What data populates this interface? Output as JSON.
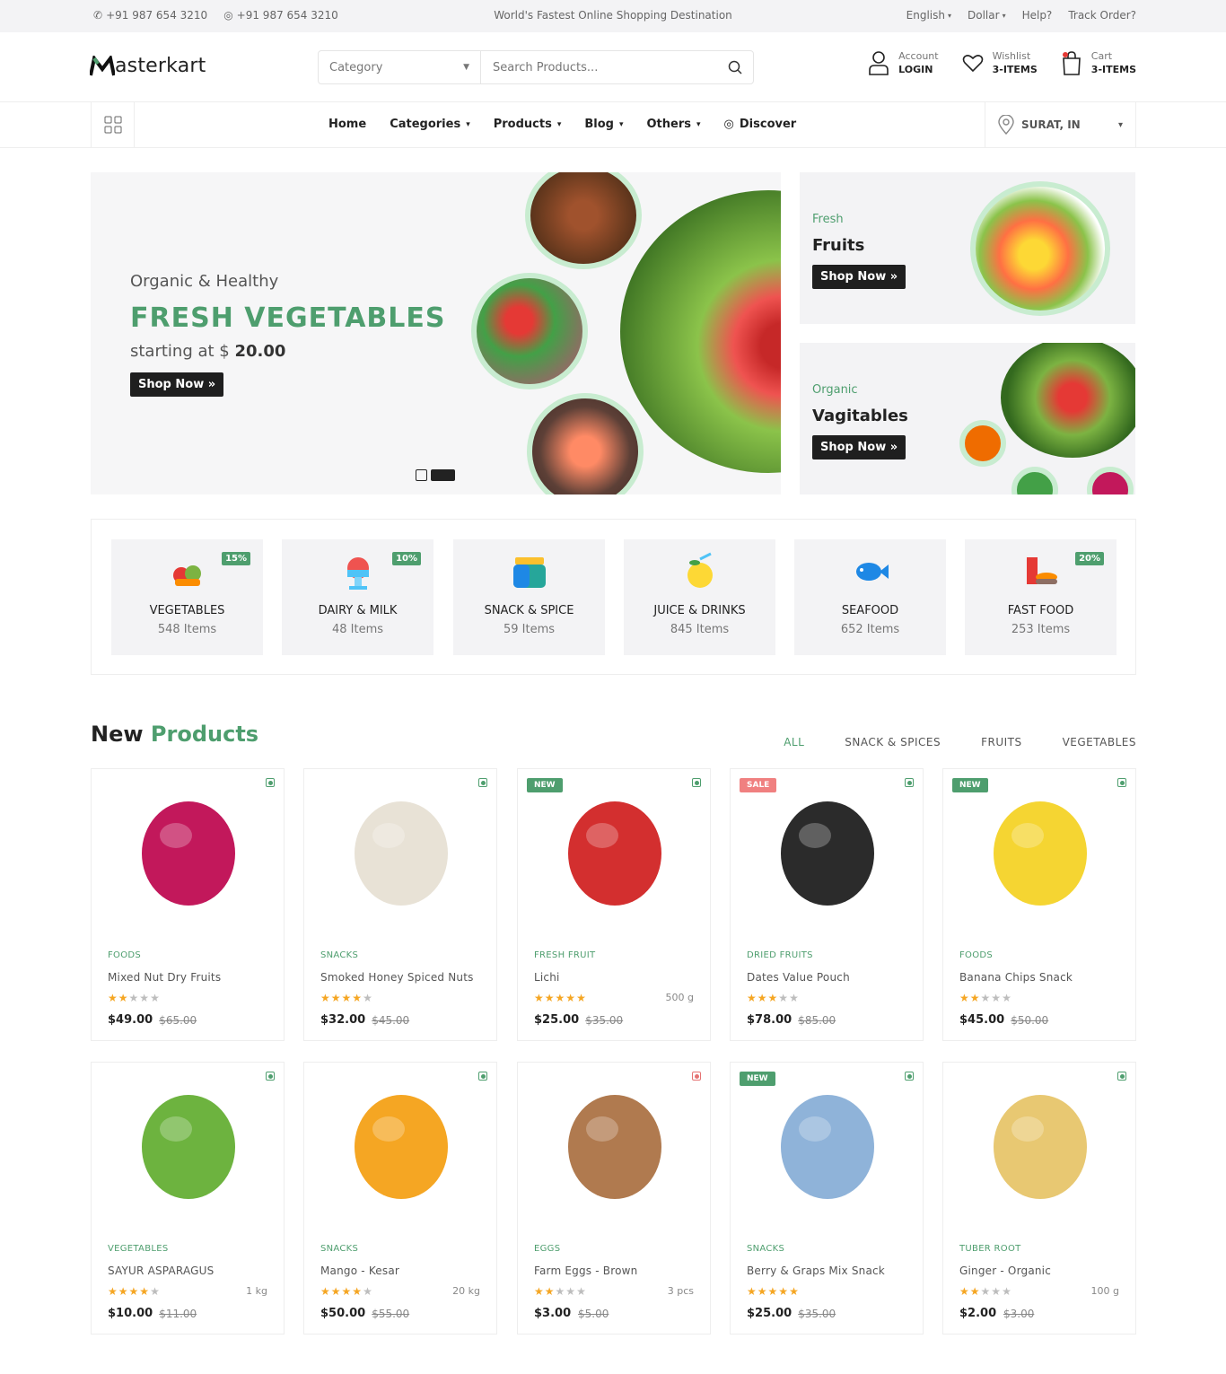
{
  "topbar": {
    "phone1": "+91 987 654 3210",
    "phone2": "+91 987 654 3210",
    "tagline": "World's Fastest Online Shopping Destination",
    "language": "English",
    "currency": "Dollar",
    "help": "Help?",
    "track": "Track Order?"
  },
  "header": {
    "logo_text": "asterkart",
    "category_label": "Category",
    "search_placeholder": "Search Products...",
    "account_label": "Account",
    "account_action": "LOGIN",
    "wishlist_label": "Wishlist",
    "wishlist_count": "3-ITEMS",
    "cart_label": "Cart",
    "cart_count": "3-ITEMS"
  },
  "nav": {
    "items": [
      "Home",
      "Categories",
      "Products",
      "Blog",
      "Others",
      "Discover"
    ],
    "location": "SURAT, IN"
  },
  "hero": {
    "subtitle": "Organic & Healthy",
    "title": "FRESH VEGETABLES",
    "price_prefix": "starting at $",
    "price": "20.00",
    "button": "Shop Now »"
  },
  "side_banners": [
    {
      "small": "Fresh",
      "big": "Fruits",
      "button": "Shop Now »"
    },
    {
      "small": "Organic",
      "big": "Vagitables",
      "button": "Shop Now »"
    }
  ],
  "categories": [
    {
      "name": "VEGETABLES",
      "count": "548 Items",
      "discount": "15%",
      "icon": "vegetables-icon"
    },
    {
      "name": "DAIRY & MILK",
      "count": "48 Items",
      "discount": "10%",
      "icon": "dairy-icon"
    },
    {
      "name": "SNACK & SPICE",
      "count": "59 Items",
      "discount": "",
      "icon": "snack-jar-icon"
    },
    {
      "name": "JUICE & DRINKS",
      "count": "845 Items",
      "discount": "",
      "icon": "juice-icon"
    },
    {
      "name": "SEAFOOD",
      "count": "652 Items",
      "discount": "",
      "icon": "fish-icon"
    },
    {
      "name": "FAST FOOD",
      "count": "253 Items",
      "discount": "20%",
      "icon": "fastfood-icon"
    }
  ],
  "new_products": {
    "title_a": "New",
    "title_b": "Products",
    "tabs": [
      "ALL",
      "SNACK & SPICES",
      "FRUITS",
      "VEGETABLES"
    ],
    "products": [
      {
        "category": "FOODS",
        "name": "Mixed Nut Dry Fruits",
        "rating": 2,
        "price": "$49.00",
        "old": "$65.00",
        "weight": "",
        "badge": "",
        "veg": "green",
        "color": "#c2185b"
      },
      {
        "category": "SNACKS",
        "name": "Smoked Honey Spiced Nuts",
        "rating": 4,
        "price": "$32.00",
        "old": "$45.00",
        "weight": "",
        "badge": "",
        "veg": "green",
        "color": "#e8e2d6"
      },
      {
        "category": "FRESH FRUIT",
        "name": "Lichi",
        "rating": 5,
        "price": "$25.00",
        "old": "$35.00",
        "weight": "500 g",
        "badge": "NEW",
        "veg": "green",
        "color": "#d32f2f"
      },
      {
        "category": "DRIED FRUITS",
        "name": "Dates Value Pouch",
        "rating": 3,
        "price": "$78.00",
        "old": "$85.00",
        "weight": "",
        "badge": "SALE",
        "veg": "green",
        "color": "#2b2b2b"
      },
      {
        "category": "FOODS",
        "name": "Banana Chips Snack",
        "rating": 2,
        "price": "$45.00",
        "old": "$50.00",
        "weight": "",
        "badge": "NEW",
        "veg": "green",
        "color": "#f5d532"
      },
      {
        "category": "VEGETABLES",
        "name": "SAYUR ASPARAGUS",
        "rating": 4,
        "price": "$10.00",
        "old": "$11.00",
        "weight": "1 kg",
        "badge": "",
        "veg": "green",
        "color": "#6db33f"
      },
      {
        "category": "SNACKS",
        "name": "Mango - Kesar",
        "rating": 4,
        "price": "$50.00",
        "old": "$55.00",
        "weight": "20 kg",
        "badge": "",
        "veg": "green",
        "color": "#f5a623"
      },
      {
        "category": "EGGS",
        "name": "Farm Eggs - Brown",
        "rating": 2,
        "price": "$3.00",
        "old": "$5.00",
        "weight": "3 pcs",
        "badge": "",
        "veg": "red",
        "color": "#b07a4f"
      },
      {
        "category": "SNACKS",
        "name": "Berry & Graps Mix Snack",
        "rating": 5,
        "price": "$25.00",
        "old": "$35.00",
        "weight": "",
        "badge": "NEW",
        "veg": "green",
        "color": "#8fb3d9"
      },
      {
        "category": "TUBER ROOT",
        "name": "Ginger - Organic",
        "rating": 2,
        "price": "$2.00",
        "old": "$3.00",
        "weight": "100 g",
        "badge": "",
        "veg": "green",
        "color": "#e8c872"
      }
    ]
  },
  "colors": {
    "accent": "#4e9e6e",
    "sale": "#f08080",
    "dark": "#1f1f1f"
  }
}
